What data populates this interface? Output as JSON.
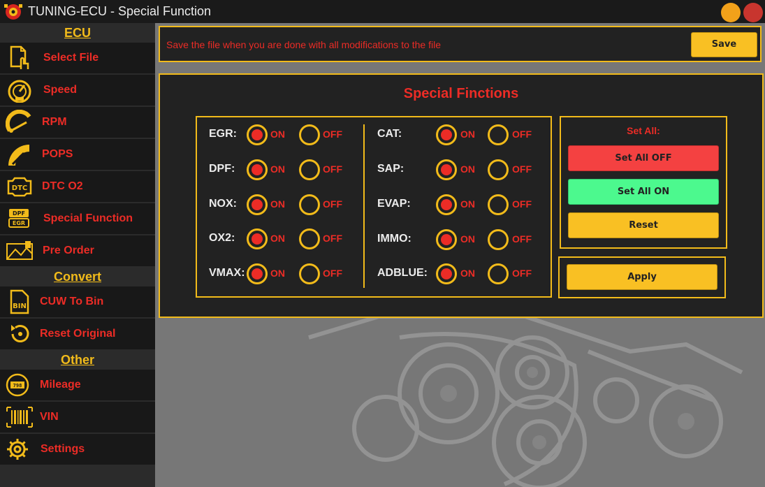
{
  "window": {
    "title": "TUNING-ECU - Special Function"
  },
  "sidebar": {
    "sections": [
      {
        "heading": "ECU",
        "items": [
          {
            "label": "Select File",
            "icon": "file-touch-icon"
          },
          {
            "label": "Speed",
            "icon": "speedometer-icon"
          },
          {
            "label": "RPM",
            "icon": "rpm-gauge-icon"
          },
          {
            "label": "POPS",
            "icon": "pops-gauge-icon"
          },
          {
            "label": "DTC O2",
            "icon": "dtc-icon"
          },
          {
            "label": "Special Function",
            "icon": "dpf-egr-icon"
          },
          {
            "label": "Pre Order",
            "icon": "pre-order-icon"
          }
        ]
      },
      {
        "heading": "Convert",
        "items": [
          {
            "label": "CUW To Bin",
            "icon": "bin-file-icon"
          },
          {
            "label": "Reset Original",
            "icon": "reset-icon"
          }
        ]
      },
      {
        "heading": "Other",
        "items": [
          {
            "label": "Mileage",
            "icon": "odometer-icon"
          },
          {
            "label": "VIN",
            "icon": "barcode-icon"
          },
          {
            "label": "Settings",
            "icon": "gear-icon"
          }
        ]
      }
    ]
  },
  "save_bar": {
    "message": "Save the file when you are done with all modifications to the file",
    "save_label": "Save"
  },
  "panel": {
    "title": "Special Finctions",
    "on_label": "ON",
    "off_label": "OFF",
    "left_options": [
      {
        "label": "EGR:",
        "selected": "ON"
      },
      {
        "label": "DPF:",
        "selected": "ON"
      },
      {
        "label": "NOX:",
        "selected": "ON"
      },
      {
        "label": "OX2:",
        "selected": "ON"
      },
      {
        "label": "VMAX:",
        "selected": "ON"
      }
    ],
    "right_options": [
      {
        "label": "CAT:",
        "selected": "ON"
      },
      {
        "label": "SAP:",
        "selected": "ON"
      },
      {
        "label": "EVAP:",
        "selected": "ON"
      },
      {
        "label": "IMMO:",
        "selected": "ON"
      },
      {
        "label": "ADBLUE:",
        "selected": "ON"
      }
    ],
    "set_all": {
      "title": "Set All:",
      "off_label": "Set All OFF",
      "on_label": "Set All ON",
      "reset_label": "Reset"
    },
    "apply_label": "Apply"
  },
  "colors": {
    "accent_yellow": "#f2bb1a",
    "text_red": "#ec2c26",
    "btn_red": "#f44141",
    "btn_green": "#4cf98e"
  }
}
